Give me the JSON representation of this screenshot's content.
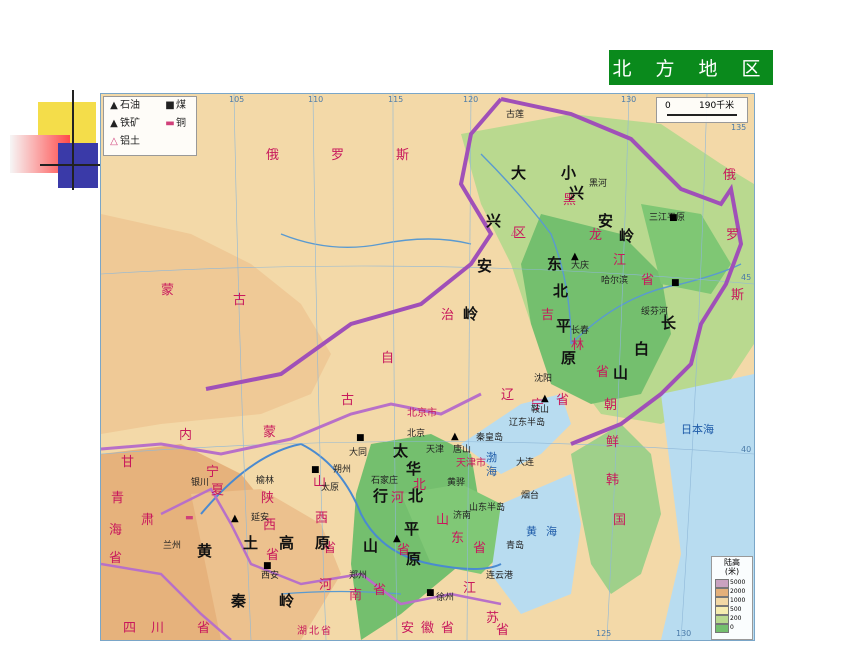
{
  "title": "北 方 地 区",
  "legend": {
    "oil": "石油",
    "coal": "煤",
    "iron": "铁矿",
    "copper": "铜",
    "bauxite": "铝土"
  },
  "scale": {
    "zero": "0",
    "distance": "190千米"
  },
  "elevation": {
    "title": "陆高",
    "unit": "(米)",
    "levels": [
      "5000",
      "2000",
      "1000",
      "500",
      "200",
      "0"
    ]
  },
  "longitude_ticks": [
    "105",
    "110",
    "115",
    "120",
    "130",
    "135"
  ],
  "longitude_ticks_bottom": [
    "125",
    "130"
  ],
  "latitude_ticks": [
    "45",
    "40"
  ],
  "regions": {
    "russia": [
      "俄",
      "罗",
      "斯"
    ],
    "russia_east": [
      "俄",
      "罗",
      "斯"
    ],
    "mongolia": [
      "蒙",
      "古"
    ],
    "inner_mongolia": [
      "内",
      "蒙",
      "古",
      "自",
      "治",
      "区"
    ],
    "heilongjiang": [
      "黑",
      "龙",
      "江",
      "省"
    ],
    "jilin": [
      "吉",
      "林",
      "省"
    ],
    "liaoning": [
      "辽",
      "宁",
      "省"
    ],
    "beijing": "北京市",
    "tianjin": "天津市",
    "hebei": [
      "河",
      "北",
      "省"
    ],
    "shanxi": [
      "山",
      "西",
      "省"
    ],
    "shaanxi": [
      "陕",
      "西",
      "省"
    ],
    "ningxia": [
      "宁",
      "夏"
    ],
    "gansu": [
      "甘",
      "肃"
    ],
    "qinghai": [
      "青",
      "海",
      "省"
    ],
    "shandong": [
      "山",
      "东",
      "省"
    ],
    "henan": [
      "河",
      "南",
      "省"
    ],
    "jiangsu": [
      "江",
      "苏",
      "省"
    ],
    "anhui": [
      "安",
      "徽",
      "省"
    ],
    "sichuan": [
      "四",
      "川",
      "省"
    ],
    "hubei": [
      "湖",
      "北",
      "省"
    ],
    "korea_north": [
      "朝",
      "鲜"
    ],
    "korea_south": [
      "韩",
      "国"
    ]
  },
  "terrain": {
    "da_xinganling": [
      "大",
      "小",
      "兴",
      "安",
      "岭"
    ],
    "xiao_xinganling": [
      "小",
      "兴",
      "安",
      "岭"
    ],
    "da_xing": [
      "兴",
      "安",
      "岭"
    ],
    "northeast_plain": [
      "东",
      "北",
      "平",
      "原"
    ],
    "changbai": [
      "长",
      "白",
      "山"
    ],
    "taihang": [
      "太",
      "行",
      "山"
    ],
    "huabei_plain": [
      "华",
      "北",
      "平",
      "原"
    ],
    "loess": [
      "黄",
      "土",
      "高",
      "原"
    ],
    "qinling": [
      "秦",
      "岭"
    ],
    "sanjiang": "三江平原",
    "shandong_peninsula": "山东半岛",
    "liaodong_peninsula": "辽东半岛"
  },
  "seas": {
    "bohai": [
      "渤",
      "海"
    ],
    "yellow_sea": [
      "黄",
      "海"
    ],
    "sea_of_japan": "日本海"
  },
  "cities": [
    "古莲",
    "大庆",
    "哈尔滨",
    "长春",
    "沈阳",
    "鞍山",
    "大连",
    "北京",
    "天津",
    "唐山",
    "秦皇岛",
    "石家庄",
    "太原",
    "大同",
    "朔州",
    "济南",
    "青岛",
    "烟台",
    "黄骅",
    "连云港",
    "郑州",
    "徐州",
    "西安",
    "兰州",
    "银川",
    "延安",
    "榆林",
    "绥芬河",
    "黑河"
  ],
  "colors": {
    "title_bg": "#0a8a1c",
    "border_purple": "#a050b8",
    "sea": "#b8dcf0",
    "plain": "#74bf6e",
    "plateau": "#f2d8a6",
    "mountain": "#e4b07a",
    "label_pink": "#c8185c"
  }
}
